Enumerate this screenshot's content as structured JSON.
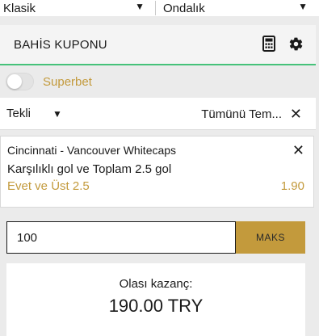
{
  "selectors": {
    "type_value": "Klasik",
    "odds_format_value": "Ondalık"
  },
  "coupon": {
    "title": "BAHİS KUPONU"
  },
  "superbet": {
    "label": "Superbet",
    "enabled": false
  },
  "bet_type": {
    "value": "Tekli",
    "clear_all_label": "Tümünü Tem..."
  },
  "selection": {
    "match": "Cincinnati - Vancouver Whitecaps",
    "market": "Karşılıklı gol ve Toplam 2.5 gol",
    "pick": "Evet ve Üst 2.5",
    "odds": "1.90"
  },
  "stake": {
    "value": "100",
    "max_label": "MAKS"
  },
  "winnings": {
    "label": "Olası kazanç:",
    "amount": "190.00 TRY"
  },
  "colors": {
    "accent_gold": "#c39a3c",
    "accent_green": "#46c27a",
    "background": "#ebebeb"
  }
}
